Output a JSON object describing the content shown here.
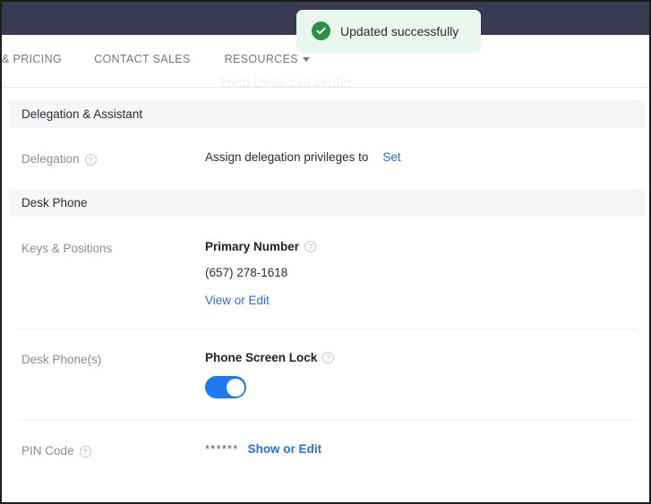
{
  "topbar": {
    "present": true,
    "color": "#383b52"
  },
  "nav": {
    "items": [
      {
        "label": "& PRICING",
        "name": "nav-pricing"
      },
      {
        "label": "CONTACT SALES",
        "name": "nav-contact-sales"
      },
      {
        "label": "RESOURCES",
        "name": "nav-resources",
        "caret": true
      }
    ],
    "watermark": "Help Desk call center"
  },
  "toast": {
    "message": "Updated successfully",
    "icon": "check-circle-icon",
    "bg_color": "#e9f7ee",
    "icon_color": "#2a9045"
  },
  "sections": [
    {
      "title": "Delegation & Assistant",
      "rows": [
        {
          "label": "Delegation",
          "label_help": "?",
          "value_text": "Assign delegation privileges to",
          "link": "Set"
        }
      ]
    },
    {
      "title": "Desk Phone",
      "rows": [
        {
          "label": "Keys & Positions",
          "value_title": "Primary Number",
          "value_help": "?",
          "value_detail": "(657) 278-1618",
          "link": "View or Edit"
        },
        {
          "label": "Desk Phone(s)",
          "value_title": "Phone Screen Lock",
          "value_help": "?",
          "toggle_on": true,
          "toggle_color": "#1f7bed"
        },
        {
          "label": "PIN Code",
          "label_help": "?",
          "masked_value": "******",
          "link": "Show or Edit"
        }
      ]
    }
  ]
}
